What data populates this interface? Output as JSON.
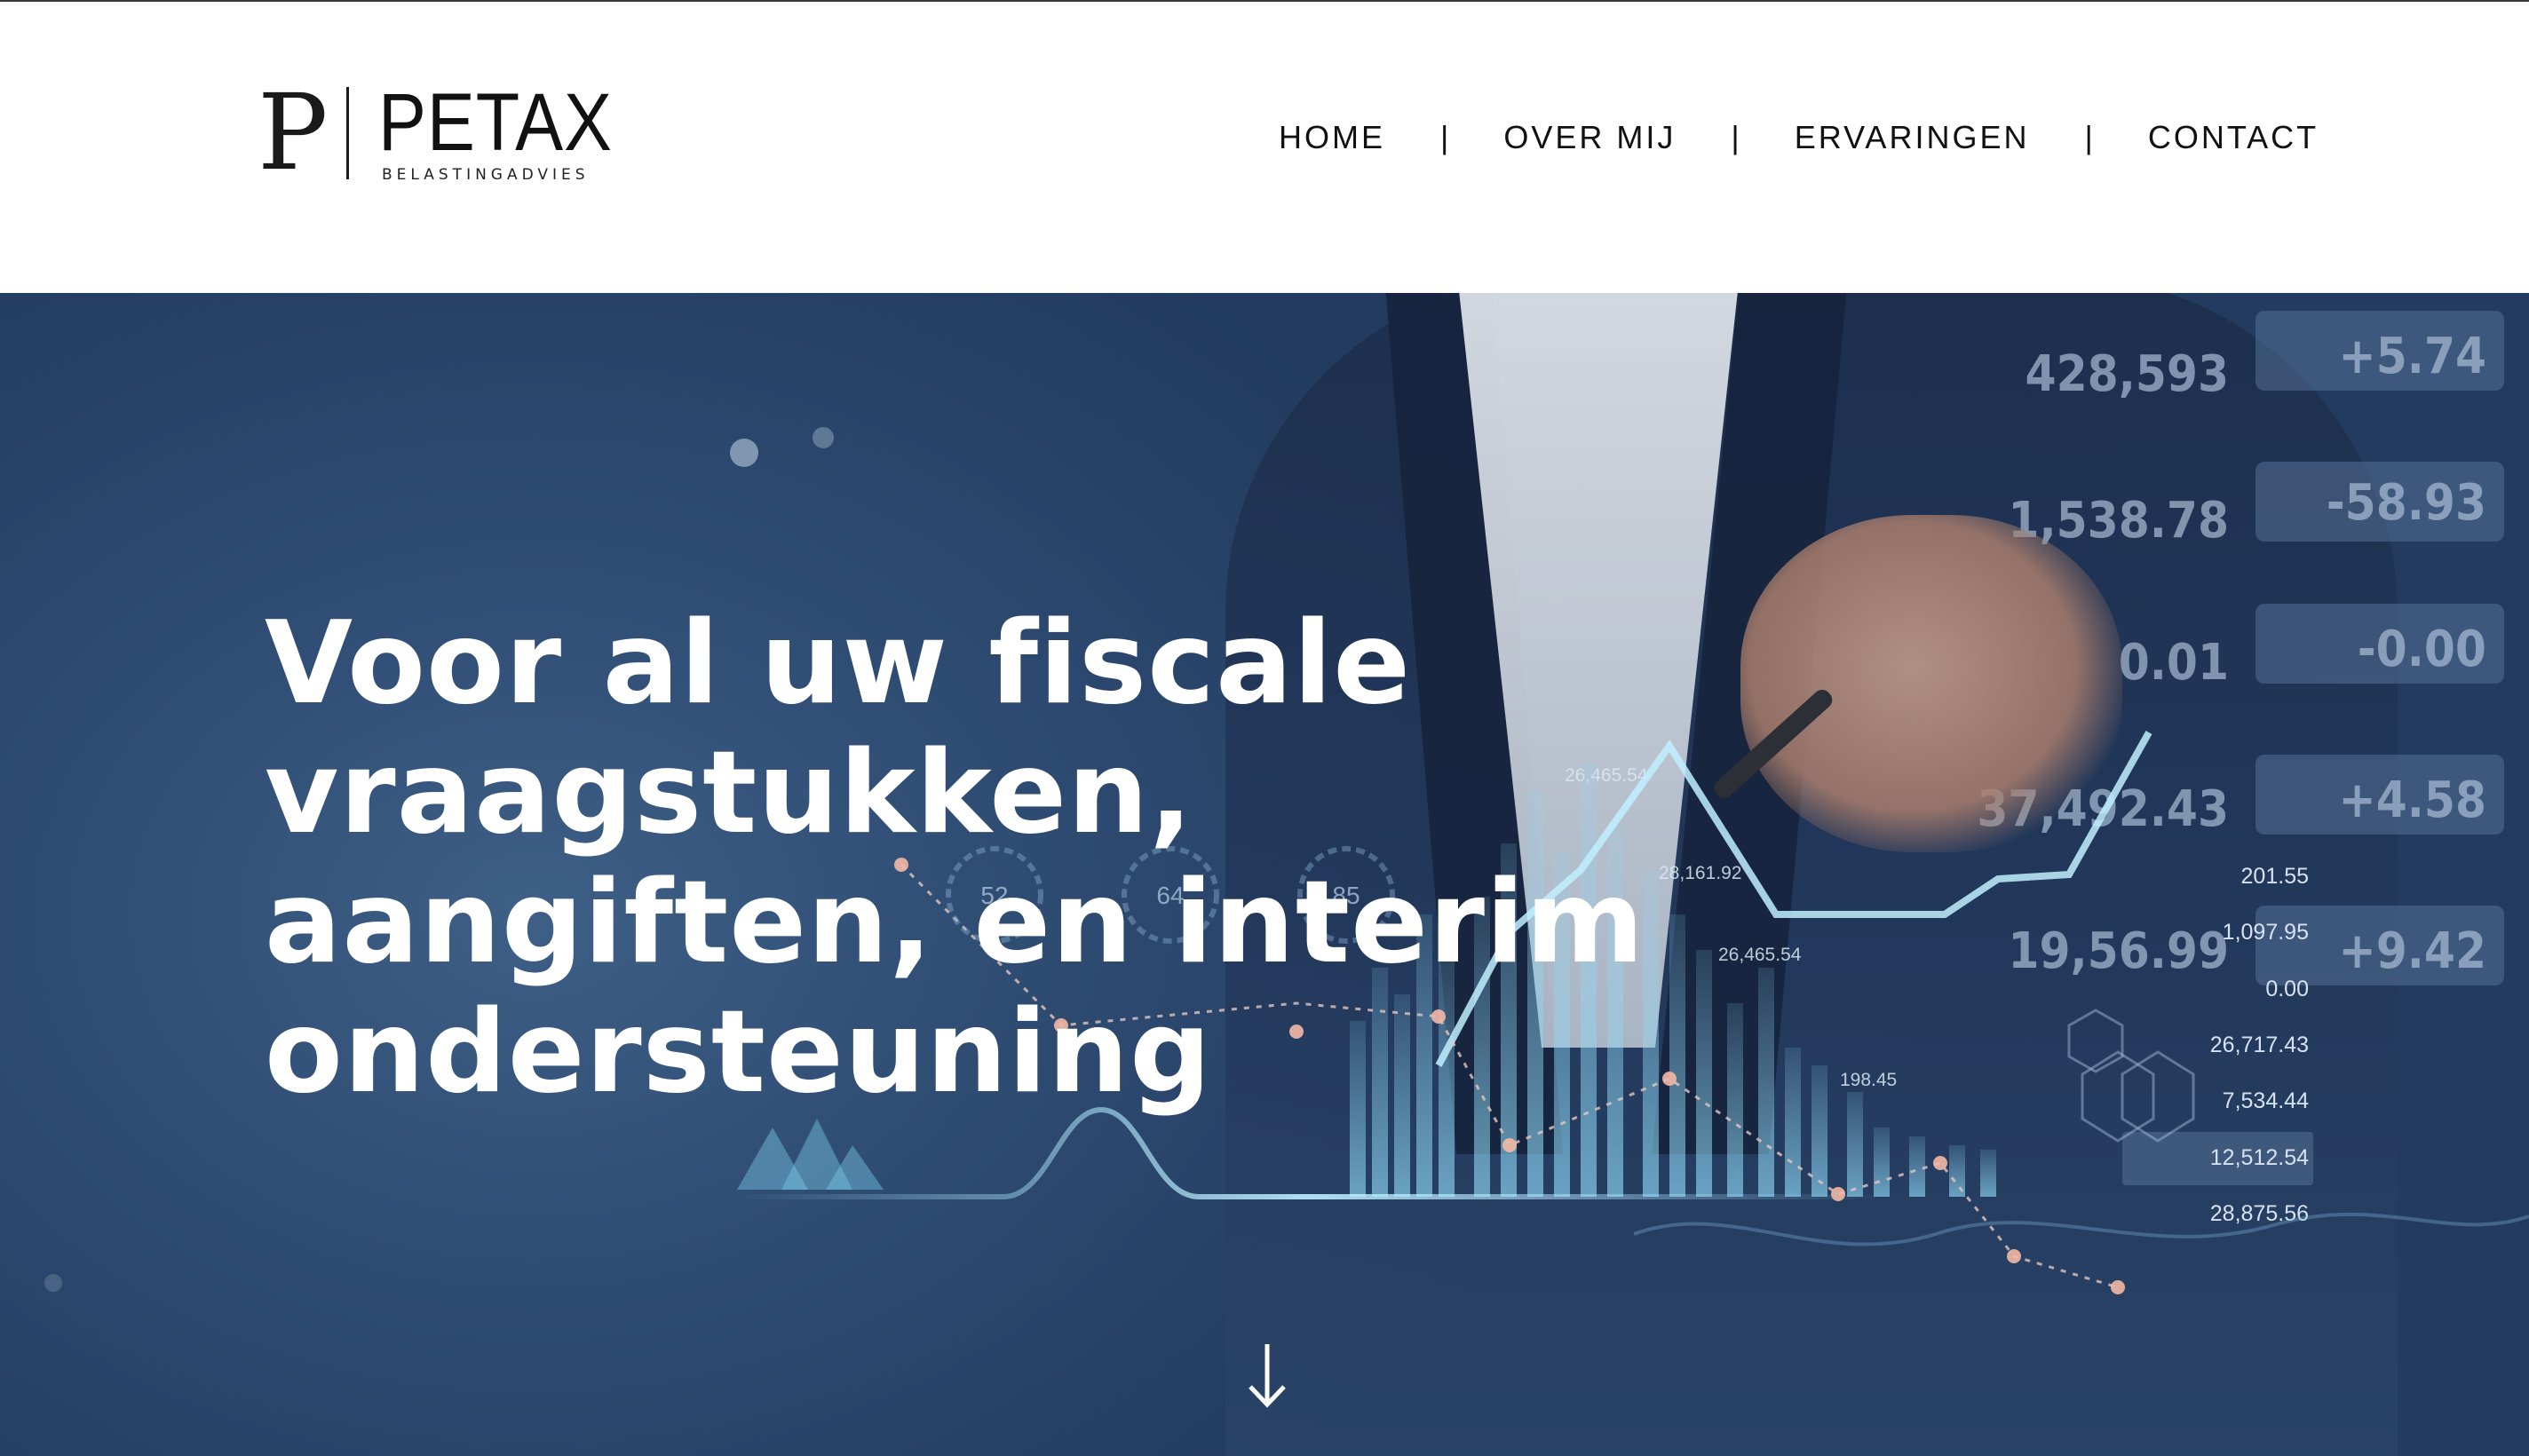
{
  "brand": {
    "initial": "P",
    "name": "PETAX",
    "tagline": "BELASTINGADVIES"
  },
  "nav": {
    "items": [
      {
        "label": "HOME"
      },
      {
        "label": "OVER MIJ"
      },
      {
        "label": "ERVARINGEN"
      },
      {
        "label": "CONTACT"
      }
    ],
    "separator": "|"
  },
  "hero": {
    "title": "Voor al uw fiscale vraagstukken, aangiften, en interim ondersteuning",
    "scroll_icon": "arrow-down-icon",
    "background_numbers": {
      "right_panel": [
        "428,593",
        "+5.74",
        "1,538.78",
        "-58.93",
        "0.01",
        "-0.00",
        "37,492.43",
        "+4.58",
        "19,56.99",
        "+9.42"
      ],
      "list": [
        "201.55",
        "1,097.95",
        "0.00",
        "26,717.43",
        "7,534.44",
        "12,512.54",
        "28,875.56"
      ],
      "bar_labels": [
        "26,465.54",
        "28,161.92",
        "26,465.54",
        "198.45"
      ],
      "gauges": [
        "52",
        "64",
        "85"
      ]
    }
  },
  "colors": {
    "hero_bg": "#2f4c73",
    "accent_glow": "#7fd3f0",
    "text_white": "#ffffff",
    "nav_text": "#111111"
  }
}
